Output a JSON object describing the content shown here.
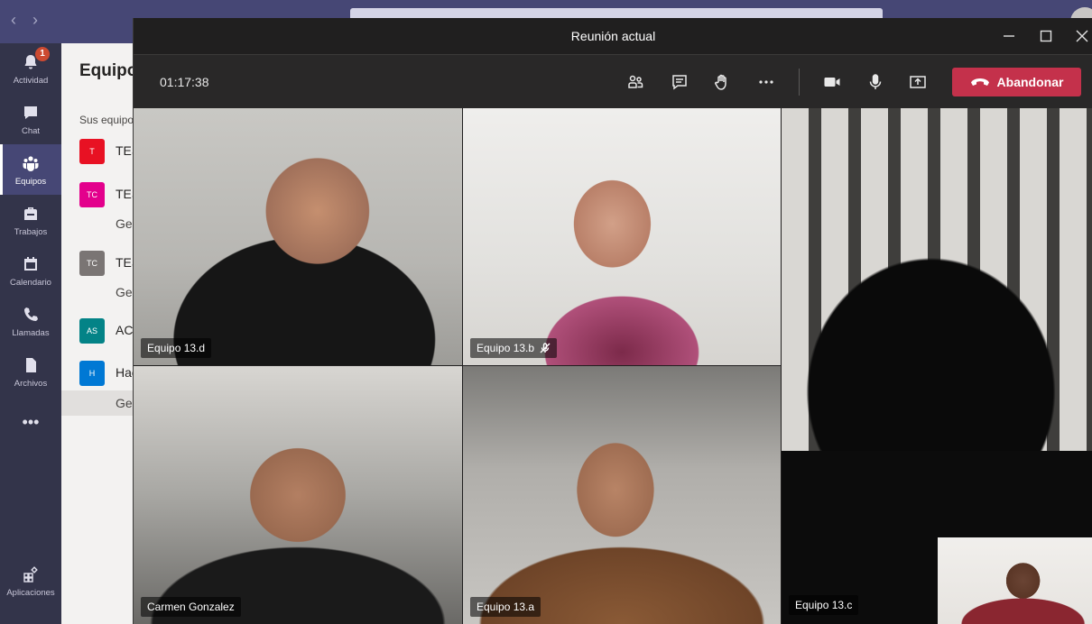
{
  "app": {
    "rail": [
      {
        "label": "Actividad",
        "icon": "bell-icon",
        "badge": "1"
      },
      {
        "label": "Chat",
        "icon": "chat-icon"
      },
      {
        "label": "Equipos",
        "icon": "teams-icon"
      },
      {
        "label": "Trabajos",
        "icon": "backpack-icon"
      },
      {
        "label": "Calendario",
        "icon": "calendar-icon"
      },
      {
        "label": "Llamadas",
        "icon": "phone-icon"
      },
      {
        "label": "Archivos",
        "icon": "file-icon"
      },
      {
        "label": "•••",
        "icon": "more-icon"
      },
      {
        "label": "Aplicaciones",
        "icon": "apps-icon"
      }
    ],
    "panel": {
      "title": "Equipo",
      "subtitle": "Sus equipo",
      "teams": [
        {
          "initials": "T",
          "name": "TES",
          "color": "#e81123"
        },
        {
          "initials": "TC",
          "name": "TES",
          "color": "#e3008c",
          "channel": "Ger"
        },
        {
          "initials": "TC",
          "name": "TES",
          "color": "#7a7574",
          "channel": "Ger"
        },
        {
          "initials": "AS",
          "name": "ACA",
          "color": "#038387"
        },
        {
          "initials": "H",
          "name": "Hac",
          "color": "#0078d4",
          "channel": "Ger"
        }
      ]
    }
  },
  "meeting": {
    "title": "Reunión actual",
    "timer": "01:17:38",
    "leave_label": "Abandonar",
    "participants": [
      {
        "name": "Equipo 13.d",
        "muted": false
      },
      {
        "name": "Equipo 13.b",
        "muted": true
      },
      {
        "name": "Equipo 13.c",
        "muted": false
      },
      {
        "name": "Carmen Gonzalez",
        "muted": false
      },
      {
        "name": "Equipo 13.a",
        "muted": false
      }
    ]
  }
}
